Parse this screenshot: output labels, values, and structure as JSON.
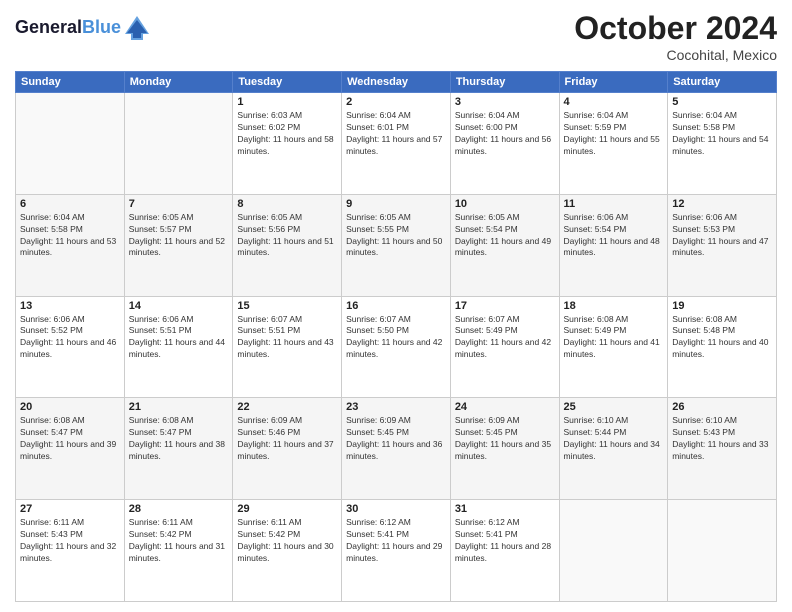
{
  "header": {
    "logo_line1": "General",
    "logo_line2": "Blue",
    "month": "October 2024",
    "location": "Cocohital, Mexico"
  },
  "weekdays": [
    "Sunday",
    "Monday",
    "Tuesday",
    "Wednesday",
    "Thursday",
    "Friday",
    "Saturday"
  ],
  "weeks": [
    [
      {
        "day": "",
        "info": ""
      },
      {
        "day": "",
        "info": ""
      },
      {
        "day": "1",
        "info": "Sunrise: 6:03 AM\nSunset: 6:02 PM\nDaylight: 11 hours and 58 minutes."
      },
      {
        "day": "2",
        "info": "Sunrise: 6:04 AM\nSunset: 6:01 PM\nDaylight: 11 hours and 57 minutes."
      },
      {
        "day": "3",
        "info": "Sunrise: 6:04 AM\nSunset: 6:00 PM\nDaylight: 11 hours and 56 minutes."
      },
      {
        "day": "4",
        "info": "Sunrise: 6:04 AM\nSunset: 5:59 PM\nDaylight: 11 hours and 55 minutes."
      },
      {
        "day": "5",
        "info": "Sunrise: 6:04 AM\nSunset: 5:58 PM\nDaylight: 11 hours and 54 minutes."
      }
    ],
    [
      {
        "day": "6",
        "info": "Sunrise: 6:04 AM\nSunset: 5:58 PM\nDaylight: 11 hours and 53 minutes."
      },
      {
        "day": "7",
        "info": "Sunrise: 6:05 AM\nSunset: 5:57 PM\nDaylight: 11 hours and 52 minutes."
      },
      {
        "day": "8",
        "info": "Sunrise: 6:05 AM\nSunset: 5:56 PM\nDaylight: 11 hours and 51 minutes."
      },
      {
        "day": "9",
        "info": "Sunrise: 6:05 AM\nSunset: 5:55 PM\nDaylight: 11 hours and 50 minutes."
      },
      {
        "day": "10",
        "info": "Sunrise: 6:05 AM\nSunset: 5:54 PM\nDaylight: 11 hours and 49 minutes."
      },
      {
        "day": "11",
        "info": "Sunrise: 6:06 AM\nSunset: 5:54 PM\nDaylight: 11 hours and 48 minutes."
      },
      {
        "day": "12",
        "info": "Sunrise: 6:06 AM\nSunset: 5:53 PM\nDaylight: 11 hours and 47 minutes."
      }
    ],
    [
      {
        "day": "13",
        "info": "Sunrise: 6:06 AM\nSunset: 5:52 PM\nDaylight: 11 hours and 46 minutes."
      },
      {
        "day": "14",
        "info": "Sunrise: 6:06 AM\nSunset: 5:51 PM\nDaylight: 11 hours and 44 minutes."
      },
      {
        "day": "15",
        "info": "Sunrise: 6:07 AM\nSunset: 5:51 PM\nDaylight: 11 hours and 43 minutes."
      },
      {
        "day": "16",
        "info": "Sunrise: 6:07 AM\nSunset: 5:50 PM\nDaylight: 11 hours and 42 minutes."
      },
      {
        "day": "17",
        "info": "Sunrise: 6:07 AM\nSunset: 5:49 PM\nDaylight: 11 hours and 42 minutes."
      },
      {
        "day": "18",
        "info": "Sunrise: 6:08 AM\nSunset: 5:49 PM\nDaylight: 11 hours and 41 minutes."
      },
      {
        "day": "19",
        "info": "Sunrise: 6:08 AM\nSunset: 5:48 PM\nDaylight: 11 hours and 40 minutes."
      }
    ],
    [
      {
        "day": "20",
        "info": "Sunrise: 6:08 AM\nSunset: 5:47 PM\nDaylight: 11 hours and 39 minutes."
      },
      {
        "day": "21",
        "info": "Sunrise: 6:08 AM\nSunset: 5:47 PM\nDaylight: 11 hours and 38 minutes."
      },
      {
        "day": "22",
        "info": "Sunrise: 6:09 AM\nSunset: 5:46 PM\nDaylight: 11 hours and 37 minutes."
      },
      {
        "day": "23",
        "info": "Sunrise: 6:09 AM\nSunset: 5:45 PM\nDaylight: 11 hours and 36 minutes."
      },
      {
        "day": "24",
        "info": "Sunrise: 6:09 AM\nSunset: 5:45 PM\nDaylight: 11 hours and 35 minutes."
      },
      {
        "day": "25",
        "info": "Sunrise: 6:10 AM\nSunset: 5:44 PM\nDaylight: 11 hours and 34 minutes."
      },
      {
        "day": "26",
        "info": "Sunrise: 6:10 AM\nSunset: 5:43 PM\nDaylight: 11 hours and 33 minutes."
      }
    ],
    [
      {
        "day": "27",
        "info": "Sunrise: 6:11 AM\nSunset: 5:43 PM\nDaylight: 11 hours and 32 minutes."
      },
      {
        "day": "28",
        "info": "Sunrise: 6:11 AM\nSunset: 5:42 PM\nDaylight: 11 hours and 31 minutes."
      },
      {
        "day": "29",
        "info": "Sunrise: 6:11 AM\nSunset: 5:42 PM\nDaylight: 11 hours and 30 minutes."
      },
      {
        "day": "30",
        "info": "Sunrise: 6:12 AM\nSunset: 5:41 PM\nDaylight: 11 hours and 29 minutes."
      },
      {
        "day": "31",
        "info": "Sunrise: 6:12 AM\nSunset: 5:41 PM\nDaylight: 11 hours and 28 minutes."
      },
      {
        "day": "",
        "info": ""
      },
      {
        "day": "",
        "info": ""
      }
    ]
  ]
}
